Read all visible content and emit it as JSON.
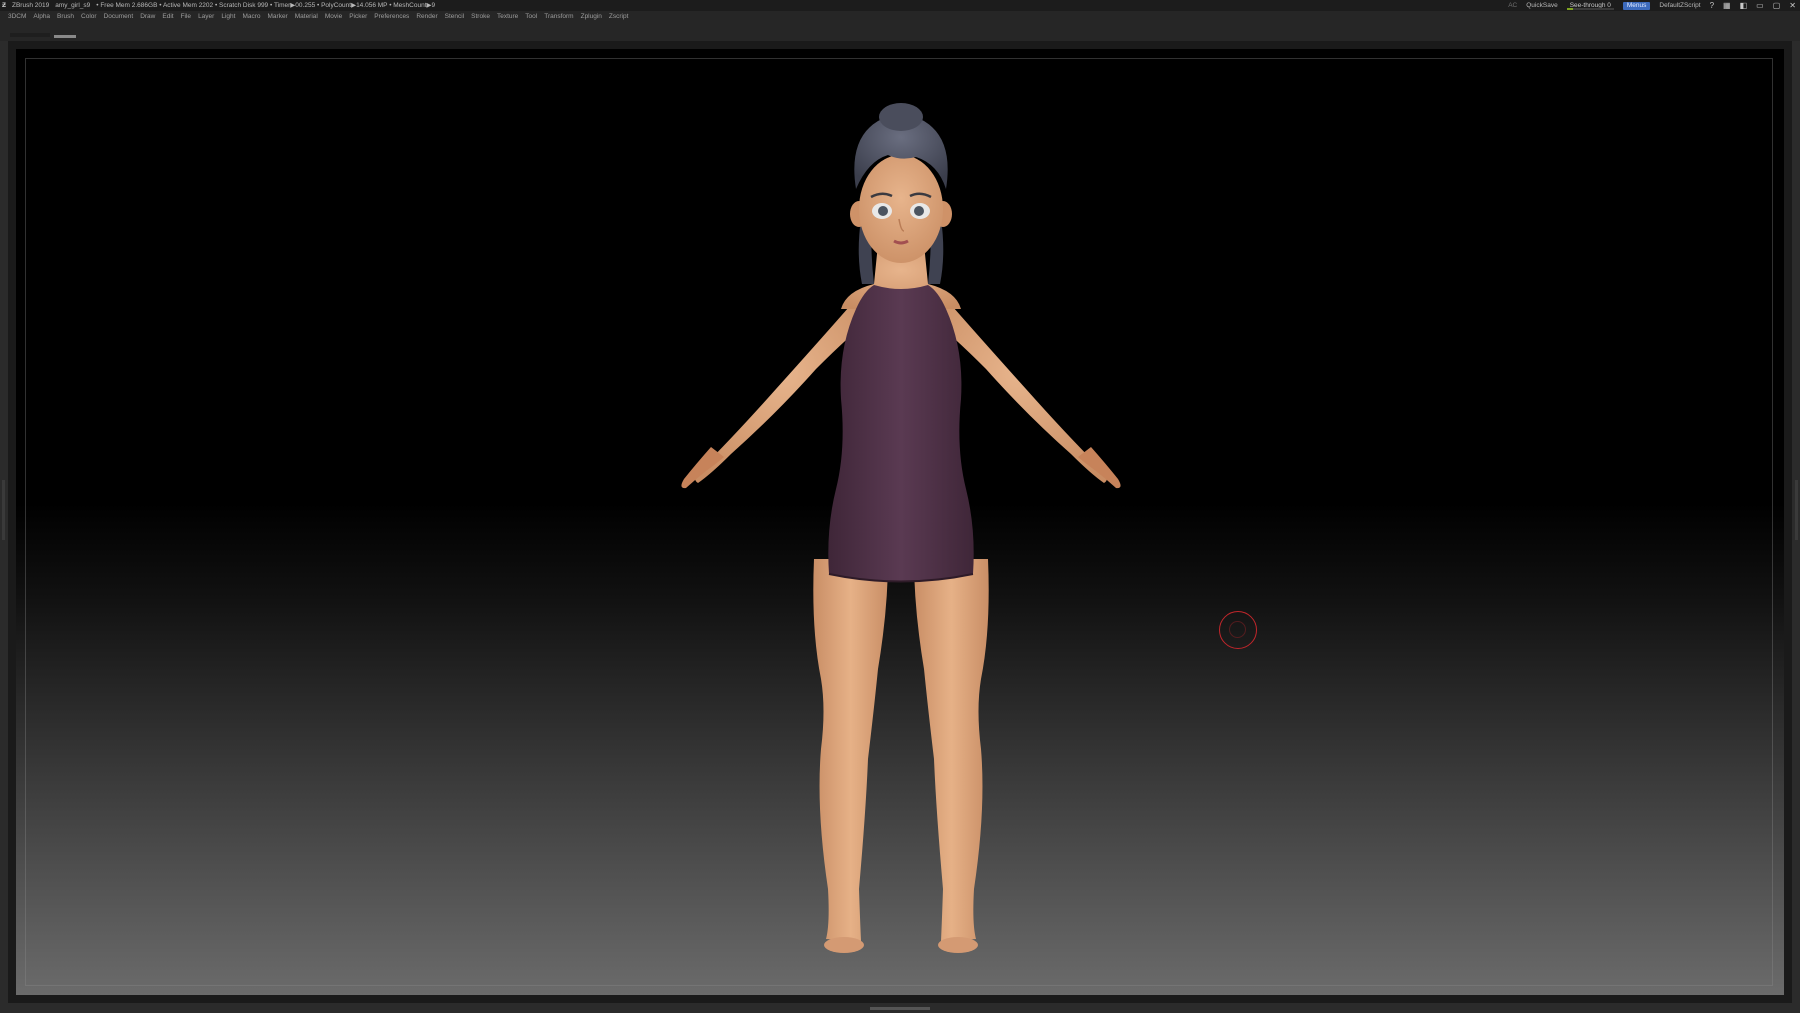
{
  "titlebar": {
    "app": "ZBrush 2019",
    "file": "amy_girl_s9",
    "stats": "• Free Mem 2.686GB • Active Mem 2202 • Scratch Disk 999 •  Timer▶00.255 • PolyCount▶14.056 MP  • MeshCount▶9",
    "ac": "AC",
    "quicksave": "QuickSave",
    "see_through": "See-through  0",
    "see_through_level": 0,
    "menus_button": "Menus",
    "script": "DefaultZScript"
  },
  "menubar": {
    "items": [
      "3DCM",
      "Alpha",
      "Brush",
      "Color",
      "Document",
      "Draw",
      "Edit",
      "File",
      "Layer",
      "Light",
      "Macro",
      "Marker",
      "Material",
      "Movie",
      "Picker",
      "Preferences",
      "Render",
      "Stencil",
      "Stroke",
      "Texture",
      "Tool",
      "Transform",
      "Zplugin",
      "Zscript"
    ]
  },
  "icons": {
    "logo": "zbrush-logo-icon",
    "window_buttons": [
      "help-icon",
      "layout-icon",
      "palette-icon",
      "minimize-icon",
      "restore-icon",
      "close-icon"
    ]
  },
  "colors": {
    "dress": "#4f3246",
    "skin": "#d9a27a",
    "hair": "#4c4f5f",
    "cursor": "#c0262b",
    "accent": "#3d6bbd"
  }
}
